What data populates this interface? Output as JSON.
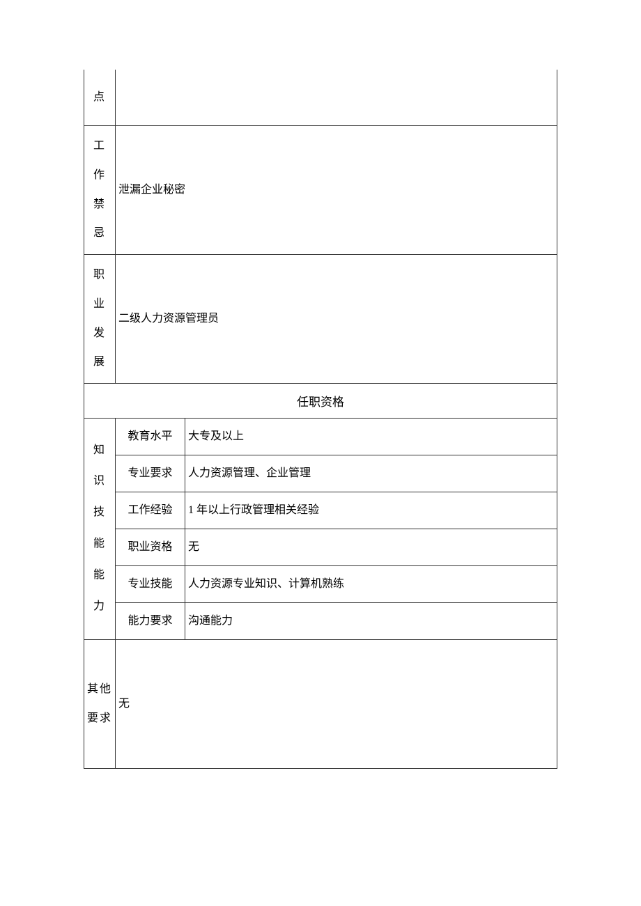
{
  "rows": {
    "point_label": "点",
    "point_value": "",
    "taboo_label": "工\n作 禁\n忌",
    "taboo_value": "泄漏企业秘密",
    "career_label": "职\n业 发\n展",
    "career_value": "二级人力资源管理员"
  },
  "qualification_header": "任职资格",
  "knowledge_label": "知\n识 技\n能 能\n力",
  "skills": [
    {
      "label": "教育水平",
      "value": "大专及以上"
    },
    {
      "label": "专业要求",
      "value": "人力资源管理、企业管理"
    },
    {
      "label": "工作经验",
      "value": "1 年以上行政管理相关经验"
    },
    {
      "label": "职业资格",
      "value": "无"
    },
    {
      "label": "专业技能",
      "value": "人力资源专业知识、计算机熟练"
    },
    {
      "label": "能力要求",
      "value": "沟通能力"
    }
  ],
  "other": {
    "label": "其他\n要求",
    "value": "无"
  }
}
